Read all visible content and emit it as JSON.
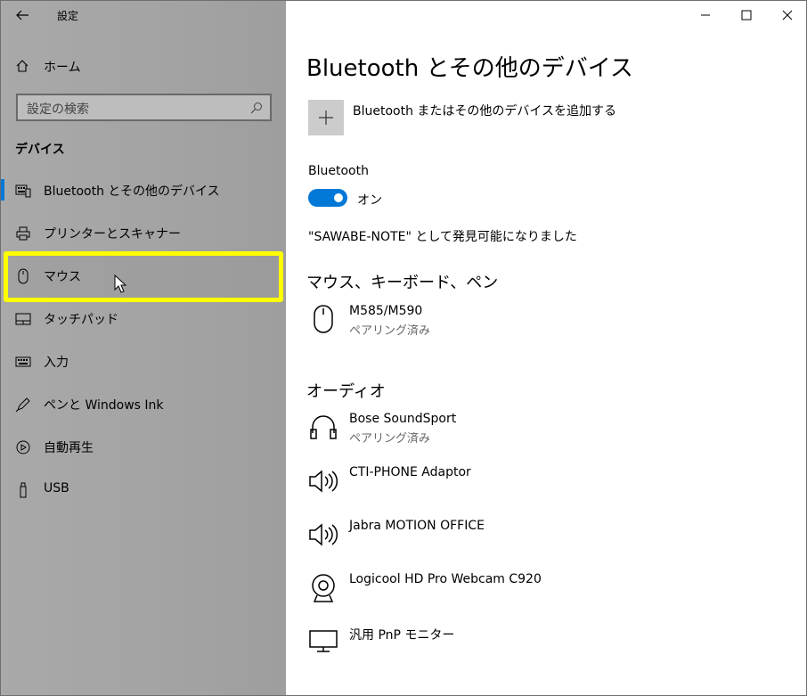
{
  "window": {
    "title": "設定"
  },
  "sidebar": {
    "home_label": "ホーム",
    "search_placeholder": "設定の検索",
    "section_title": "デバイス",
    "items": [
      {
        "label": "Bluetooth とその他のデバイス",
        "icon": "bluetooth-devices-icon",
        "selected": true
      },
      {
        "label": "プリンターとスキャナー",
        "icon": "printer-icon"
      },
      {
        "label": "マウス",
        "icon": "mouse-icon",
        "highlighted": true
      },
      {
        "label": "タッチパッド",
        "icon": "touchpad-icon"
      },
      {
        "label": "入力",
        "icon": "keyboard-icon"
      },
      {
        "label": "ペンと Windows Ink",
        "icon": "pen-icon"
      },
      {
        "label": "自動再生",
        "icon": "autoplay-icon"
      },
      {
        "label": "USB",
        "icon": "usb-icon"
      }
    ]
  },
  "main": {
    "title": "Bluetooth とその他のデバイス",
    "add_device_label": "Bluetooth またはその他のデバイスを追加する",
    "bluetooth_label": "Bluetooth",
    "bluetooth_state": "オン",
    "discoverable_text": "\"SAWABE-NOTE\" として発見可能になりました",
    "groups": [
      {
        "title": "マウス、キーボード、ペン",
        "devices": [
          {
            "name": "M585/M590",
            "status": "ペアリング済み",
            "icon": "mouse-icon"
          }
        ]
      },
      {
        "title": "オーディオ",
        "devices": [
          {
            "name": "Bose SoundSport",
            "status": "ペアリング済み",
            "icon": "headphones-icon"
          },
          {
            "name": "CTI-PHONE Adaptor",
            "status": "",
            "icon": "speaker-icon"
          },
          {
            "name": "Jabra MOTION OFFICE",
            "status": "",
            "icon": "speaker-icon"
          },
          {
            "name": "Logicool HD Pro Webcam C920",
            "status": "",
            "icon": "webcam-icon"
          },
          {
            "name": "汎用 PnP モニター",
            "status": "",
            "icon": "monitor-icon"
          }
        ]
      }
    ]
  },
  "colors": {
    "accent": "#0078d7",
    "highlight": "#ffff00",
    "sidebar_bg": "#a6a6a6"
  }
}
